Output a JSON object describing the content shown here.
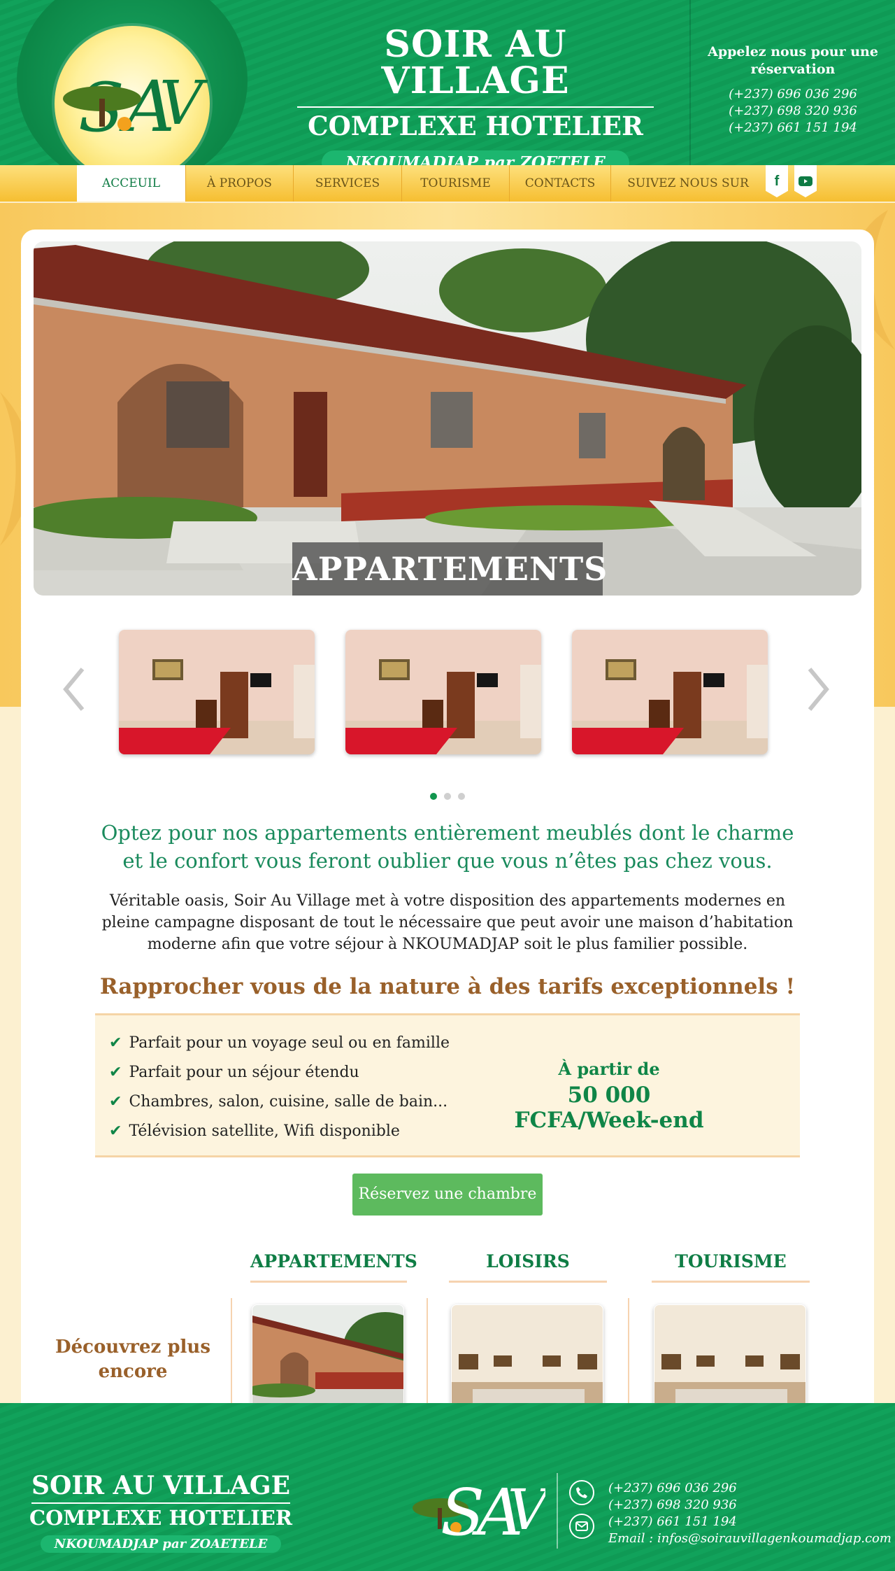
{
  "header": {
    "title": "SOIR AU VILLAGE",
    "subtitle": "COMPLEXE HOTELIER",
    "location": "NKOUMADJAP par ZOETELE",
    "contact_title": "Appelez nous pour une réservation",
    "phones": [
      "(+237) 696 036 296",
      "(+237) 698 320 936",
      "(+237) 661 151 194"
    ]
  },
  "nav": {
    "items": [
      "ACCEUIL",
      "À PROPOS",
      "SERVICES",
      "TOURISME",
      "CONTACTS",
      "SUIVEZ NOUS SUR"
    ],
    "active": "ACCEUIL"
  },
  "hero": {
    "caption": "APPARTEMENTS"
  },
  "content": {
    "lead": "Optez pour nos appartements entièrement meublés dont le charme et le confort vous feront oublier que vous n’êtes pas chez vous.",
    "body": "Véritable oasis, Soir Au Village met à votre disposition des appartements modernes en pleine campagne disposant de tout le nécessaire que peut avoir une maison d’habitation moderne afin que votre séjour à NKOUMADJAP soit le plus familier possible.",
    "promo": "Rapprocher vous de la nature à des tarifs exceptionnels !",
    "features": [
      "Parfait pour un voyage seul ou en famille",
      "Parfait pour un séjour étendu",
      "Chambres, salon, cuisine, salle de bain...",
      "Télévision satellite, Wifi disponible"
    ],
    "price_label": "À partir de",
    "price_value": "50 000 FCFA/Week-end",
    "reserve_button": "Réservez une chambre"
  },
  "discover": {
    "label": "Découvrez plus encore",
    "sections": [
      "APPARTEMENTS",
      "LOISIRS",
      "TOURISME"
    ]
  },
  "footer": {
    "title": "SOIR AU VILLAGE",
    "subtitle": "COMPLEXE HOTELIER",
    "location": "NKOUMADJAP par ZOAETELE",
    "phones": [
      "(+237) 696 036 296",
      "(+237) 698 320 936",
      "(+237) 661 151 194"
    ],
    "email": "Email : infos@soirauvillagenkoumadjap.com"
  },
  "colors": {
    "brand_green": "#0f9a55",
    "accent_gold": "#f6be31",
    "heading_brown": "#99602a"
  }
}
